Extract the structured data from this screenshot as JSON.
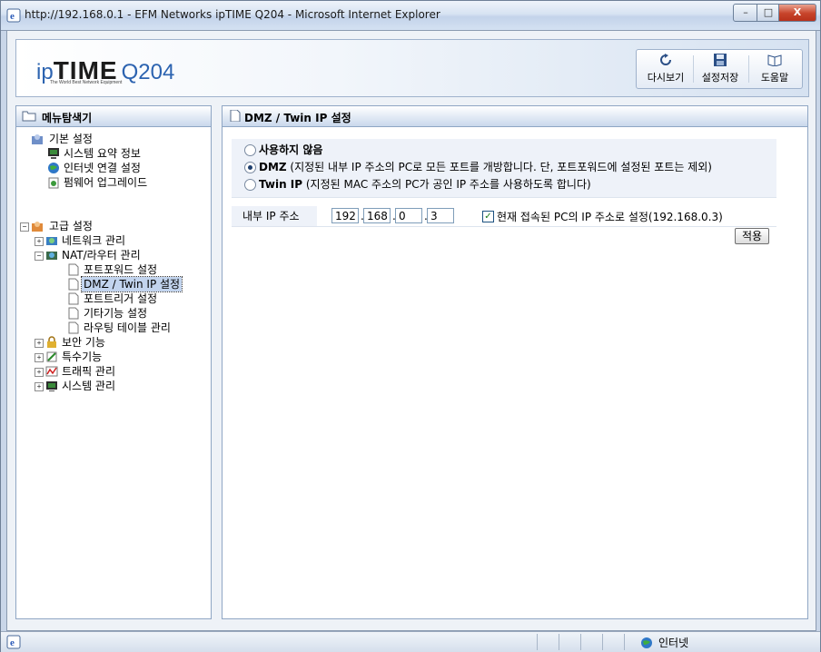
{
  "window": {
    "title": "http://192.168.0.1 - EFM Networks ipTIME Q204 - Microsoft Internet Explorer",
    "min_label": "–",
    "max_label": "□",
    "close_label": "X"
  },
  "header": {
    "logo_ip": "ip",
    "logo_time": "TIME",
    "logo_model": "Q204",
    "logo_tagline": "The World Best Network Equipment",
    "toolbar": {
      "reload_label": "다시보기",
      "save_label": "설정저장",
      "help_label": "도움말"
    }
  },
  "sidebar": {
    "title": "메뉴탐색기",
    "basic": {
      "label": "기본 설정",
      "items": [
        {
          "label": "시스템 요약 정보",
          "icon": "monitor-icon"
        },
        {
          "label": "인터넷 연결 설정",
          "icon": "globe-icon"
        },
        {
          "label": "펌웨어 업그레이드",
          "icon": "upgrade-icon"
        }
      ]
    },
    "advanced": {
      "label": "고급 설정",
      "expand_minus": "−",
      "expand_plus": "+",
      "groups": [
        {
          "label": "네트워크 관리",
          "icon": "network-icon"
        },
        {
          "label": "NAT/라우터 관리",
          "icon": "router-icon"
        }
      ],
      "nat_children": [
        {
          "label": "포트포워드 설정"
        },
        {
          "label": "DMZ / Twin IP 설정",
          "selected": true
        },
        {
          "label": "포트트리거 설정"
        },
        {
          "label": "기타기능 설정"
        },
        {
          "label": "라우팅 테이블 관리"
        }
      ],
      "more_groups": [
        {
          "label": "보안 기능",
          "icon": "lock-icon"
        },
        {
          "label": "특수기능",
          "icon": "tools-icon"
        },
        {
          "label": "트래픽 관리",
          "icon": "traffic-icon"
        },
        {
          "label": "시스템 관리",
          "icon": "system-icon"
        }
      ]
    }
  },
  "main": {
    "title": "DMZ / Twin IP 설정",
    "options": [
      {
        "label": "사용하지 않음",
        "desc": "",
        "checked": false
      },
      {
        "label": "DMZ",
        "desc": " (지정된 내부 IP 주소의 PC로 모든 포트를 개방합니다. 단, 포트포워드에 설정된 포트는 제외)",
        "checked": true
      },
      {
        "label": "Twin IP",
        "desc": " (지정된 MAC 주소의 PC가 공인 IP 주소를 사용하도록 합니다)",
        "checked": false
      }
    ],
    "ip_label": "내부 IP 주소",
    "ip": [
      "192",
      "168",
      "0",
      "3"
    ],
    "ip_dot": ".",
    "use_current_checked": true,
    "use_current_mark": "✓",
    "use_current_label": "현재 접속된 PC의 IP 주소로 설정(192.168.0.3)",
    "apply_label": "적용"
  },
  "statusbar": {
    "zone_label": "인터넷"
  }
}
